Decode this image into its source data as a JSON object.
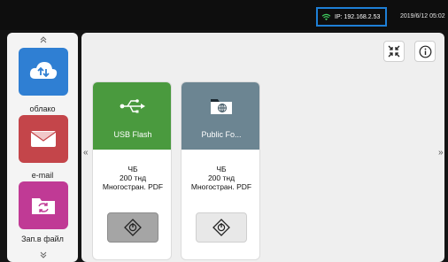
{
  "status_bar": {
    "ip": "IP: 192.168.2.53",
    "datetime": "2019/6/12 05:02",
    "icons": [
      "wifi-icon"
    ]
  },
  "sidebar": {
    "items": [
      {
        "label": "облако",
        "icon": "cloud-sync-icon",
        "color": "#2f7fd3"
      },
      {
        "label": "e-mail",
        "icon": "envelope-icon",
        "color": "#c4454a"
      },
      {
        "label": "Зап.в файл",
        "icon": "folder-sync-icon",
        "color": "#c03a95"
      }
    ],
    "icons": [
      "chevron-up-icon",
      "chevron-down-icon"
    ]
  },
  "toolbar": {
    "icons": [
      "collapse-icon",
      "info-icon"
    ]
  },
  "navigation": {
    "prev": "«",
    "next": "»"
  },
  "cards": [
    {
      "title": "USB Flash",
      "icon": "usb-icon",
      "header_color": "#4a9a3e",
      "color_mode": "ЧБ",
      "resolution": "200 тнд",
      "format": "Многостран. PDF",
      "button_color": "#a5a5a5",
      "button_icon": "start-icon"
    },
    {
      "title": "Public Fo...",
      "icon": "network-folder-icon",
      "header_color": "#6c8592",
      "color_mode": "ЧБ",
      "resolution": "200 тнд",
      "format": "Многостран. PDF",
      "button_color": "#e8e8e8",
      "button_icon": "start-icon"
    }
  ]
}
